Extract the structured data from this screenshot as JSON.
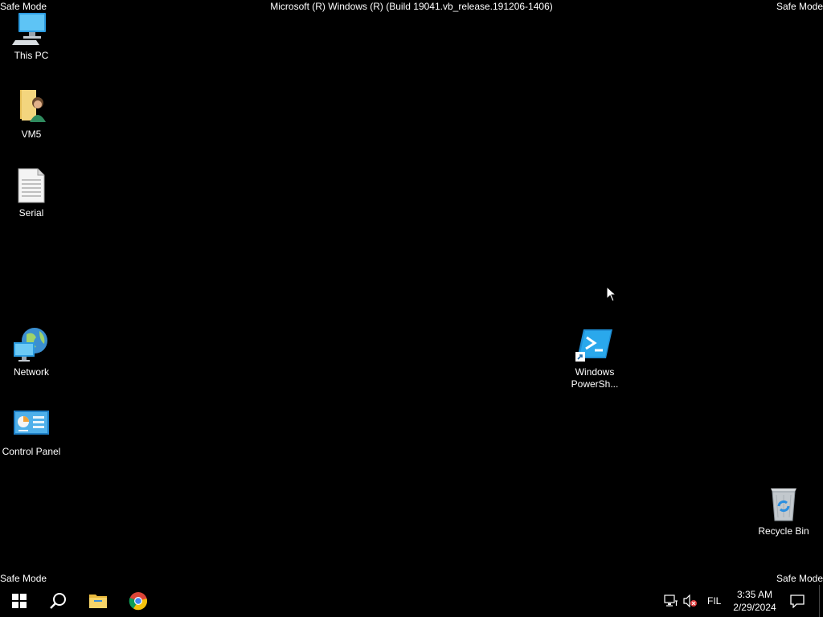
{
  "watermark": {
    "top_left": "Safe Mode",
    "top_right": "Safe Mode",
    "bottom_left": "Safe Mode",
    "bottom_right": "Safe Mode",
    "build": "Microsoft (R) Windows (R) (Build 19041.vb_release.191206-1406)"
  },
  "desktop_icons": [
    {
      "label": "This PC",
      "icon": "computer-icon"
    },
    {
      "label": "VM5",
      "icon": "user-folder-icon"
    },
    {
      "label": "Serial",
      "icon": "text-document-icon"
    },
    {
      "label": "Network",
      "icon": "network-globe-icon"
    },
    {
      "label": "Control Panel",
      "icon": "control-panel-icon"
    },
    {
      "label_line1": "Windows",
      "label_line2": "PowerSh...",
      "icon": "powershell-shortcut-icon"
    },
    {
      "label": "Recycle Bin",
      "icon": "recycle-bin-icon"
    }
  ],
  "taskbar": {
    "pinned": [
      "start-icon",
      "search-icon",
      "file-explorer-icon",
      "chrome-icon"
    ],
    "tray_icons": [
      "network-icon",
      "volume-muted-icon"
    ],
    "language": "FIL",
    "time": "3:35 AM",
    "date": "2/29/2024"
  },
  "colors": {
    "background": "#000000",
    "text": "#ffffff",
    "powershell": "#1f8fd6",
    "folder": "#e8c15a"
  }
}
